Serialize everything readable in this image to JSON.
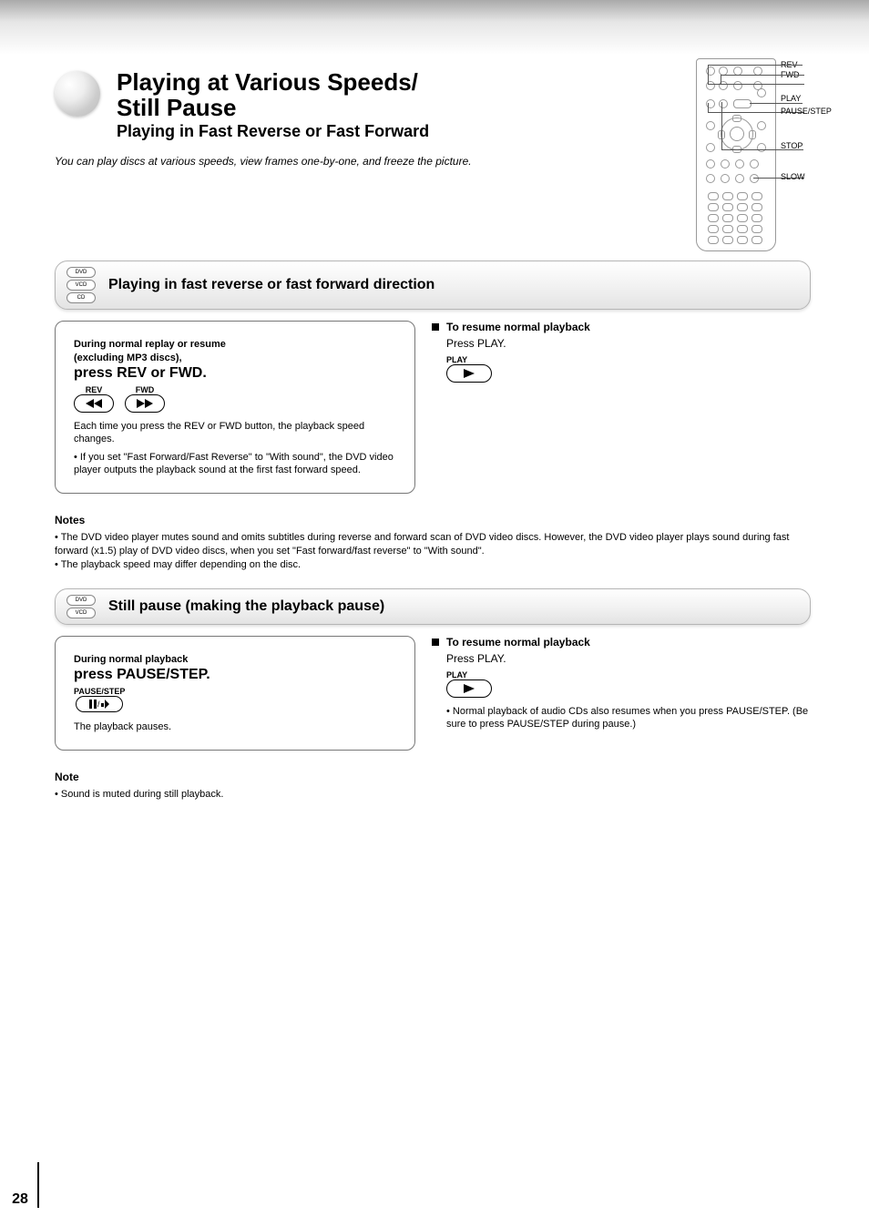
{
  "page_number": "28",
  "title_line1": "Playing at Various Speeds/",
  "title_line2": "Still Pause",
  "subtitle": "Playing in Fast Reverse or Fast Forward",
  "intro": "You can play discs at various speeds, view frames one-by-one, and freeze the picture.",
  "remote_labels": {
    "rev": "REV",
    "fwd": "FWD",
    "play": "PLAY",
    "pause": "PAUSE/STEP",
    "stop": "STOP",
    "slow": "SLOW"
  },
  "sect1": {
    "pills": [
      "DVD",
      "VCD",
      "CD"
    ],
    "title": "Playing in fast reverse or fast forward direction",
    "box": {
      "line1": "During normal replay or resume",
      "line2": "(excluding MP3 discs),",
      "step": "press REV or FWD.",
      "btn_rev": "REV",
      "btn_fwd": "FWD",
      "note1": "Each time you press the REV or FWD button, the playback speed changes.",
      "note2": "• If you set \"Fast Forward/Fast Reverse\" to \"With sound\", the DVD video player outputs the playback sound at the first fast forward speed."
    },
    "resume_title": "To resume normal playback",
    "resume_text": "Press PLAY.",
    "play_lbl": "PLAY"
  },
  "notes1": {
    "hd": "Notes",
    "items": [
      "• The DVD video player mutes sound and omits subtitles during reverse and forward scan of DVD video discs. However, the DVD video player plays sound during fast forward (x1.5) play of DVD video discs, when you set \"Fast forward/fast reverse\" to \"With sound\".",
      "• The playback speed may differ depending on the disc."
    ]
  },
  "sect2": {
    "pills": [
      "DVD",
      "VCD"
    ],
    "title": "Still pause (making the playback pause)",
    "box": {
      "line1": "During normal playback",
      "step": "press PAUSE/STEP.",
      "btn": "PAUSE/STEP",
      "note": "The playback pauses."
    },
    "resume_title": "To resume normal playback",
    "resume_text": "Press PLAY.",
    "play_lbl": "PLAY",
    "resume_note": "• Normal playback of audio CDs also resumes when you press PAUSE/STEP. (Be sure to press PAUSE/STEP during pause.)"
  },
  "notes2": {
    "hd": "Note",
    "items": [
      "• Sound is muted during still playback."
    ]
  }
}
